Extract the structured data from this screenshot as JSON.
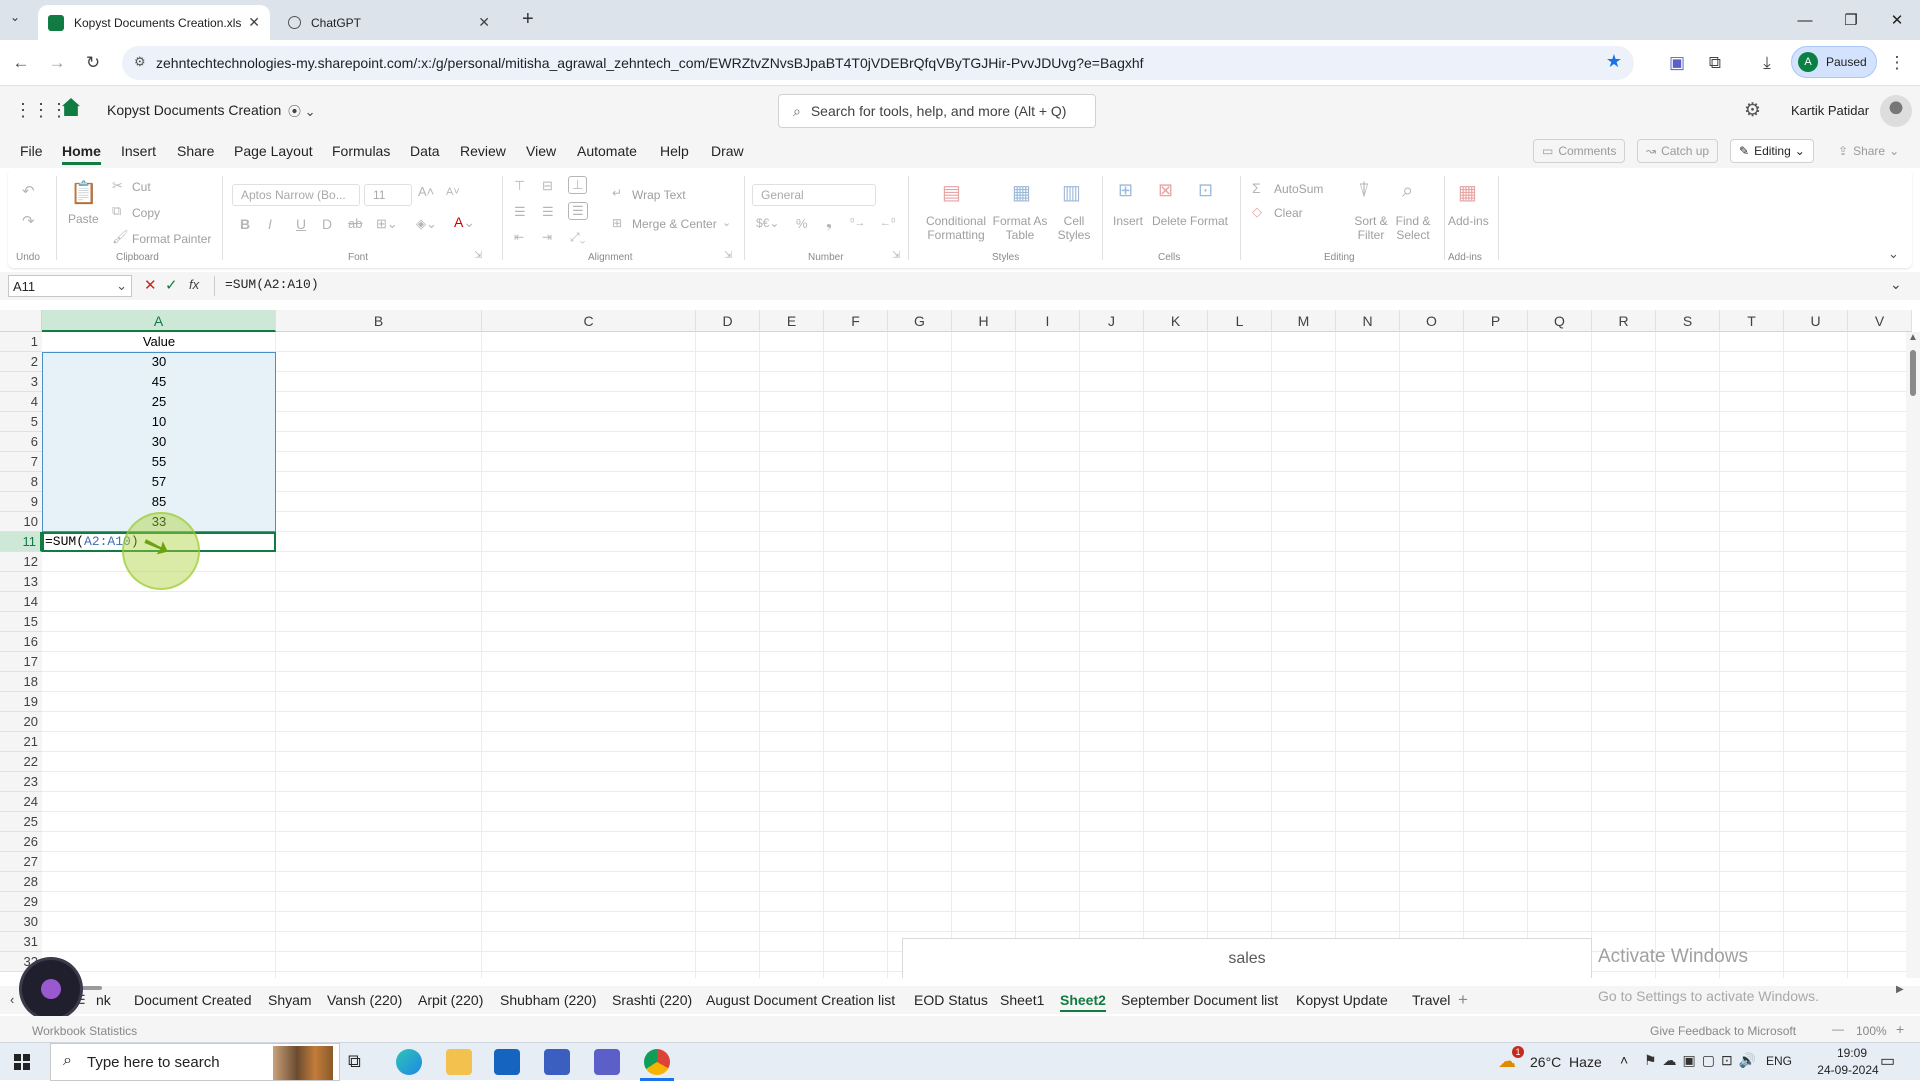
{
  "browser": {
    "tabs": [
      {
        "title": "Kopyst Documents Creation.xls",
        "active": true
      },
      {
        "title": "ChatGPT",
        "active": false
      }
    ],
    "url": "zehntechtechnologies-my.sharepoint.com/:x:/g/personal/mitisha_agrawal_zehntech_com/EWRZtvZNvsBJpaBT4T0jVDEBrQfqVByTGJHir-PvvJDUvg?e=Bagxhf",
    "profile_initial": "A",
    "profile_status": "Paused"
  },
  "app": {
    "workbook_title": "Kopyst Documents Creation",
    "search_placeholder": "Search for tools, help, and more (Alt + Q)",
    "user_name": "Kartik Patidar",
    "accent": "#107c41"
  },
  "ribbon_tabs": [
    "File",
    "Home",
    "Insert",
    "Share",
    "Page Layout",
    "Formulas",
    "Data",
    "Review",
    "View",
    "Automate",
    "Help",
    "Draw"
  ],
  "top_buttons": {
    "comments": "Comments",
    "catch_up": "Catch up",
    "editing": "Editing",
    "share": "Share"
  },
  "ribbon": {
    "undo_group": "Undo",
    "paste": "Paste",
    "cut": "Cut",
    "copy": "Copy",
    "format_painter": "Format Painter",
    "clipboard_group": "Clipboard",
    "font_name": "Aptos Narrow (Bo...",
    "font_size": "11",
    "font_group": "Font",
    "wrap_text": "Wrap Text",
    "merge_center": "Merge & Center",
    "alignment_group": "Alignment",
    "number_format": "General",
    "number_group": "Number",
    "conditional_formatting": "Conditional Formatting",
    "format_as_table": "Format As Table",
    "cell_styles": "Cell Styles",
    "styles_group": "Styles",
    "insert": "Insert",
    "delete": "Delete",
    "format": "Format",
    "cells_group": "Cells",
    "autosum": "AutoSum",
    "clear": "Clear",
    "sort_filter": "Sort & Filter",
    "find_select": "Find & Select",
    "editing_group": "Editing",
    "addins": "Add-ins",
    "addins_group": "Add-ins"
  },
  "formula_bar": {
    "name_box": "A11",
    "formula": "=SUM(A2:A10)"
  },
  "grid": {
    "columns": [
      "A",
      "B",
      "C",
      "D",
      "E",
      "F",
      "G",
      "H",
      "I",
      "J",
      "K",
      "L",
      "M",
      "N",
      "O",
      "P",
      "Q",
      "R",
      "S",
      "T",
      "U",
      "V"
    ],
    "rows": [
      "1",
      "2",
      "3",
      "4",
      "5",
      "6",
      "7",
      "8",
      "9",
      "10",
      "11",
      "12",
      "13",
      "14",
      "15",
      "16",
      "17",
      "18",
      "19",
      "20",
      "21",
      "22",
      "23",
      "24",
      "25",
      "26",
      "27",
      "28",
      "29",
      "30",
      "31",
      "32"
    ],
    "column_a": [
      "Value",
      "30",
      "45",
      "25",
      "10",
      "30",
      "55",
      "57",
      "85",
      "33"
    ],
    "editing_cell_prefix": "=SUM(",
    "editing_cell_ref": "A2:A10",
    "editing_cell_suffix": ")",
    "chart_title": "sales",
    "watermark_title": "Activate Windows",
    "watermark_sub": "Go to Settings to activate Windows."
  },
  "sheet_tabs": [
    "nk",
    "Document Created",
    "Shyam",
    "Vansh (220)",
    "Arpit (220)",
    "Shubham (220)",
    "Srashti (220)",
    "August Document Creation list",
    "EOD Status",
    "Sheet1",
    "Sheet2",
    "September Document list",
    "Kopyst Update",
    "Travel"
  ],
  "active_sheet": "Sheet2",
  "status": {
    "left": "Workbook Statistics",
    "feedback": "Give Feedback to Microsoft",
    "zoom": "100%"
  },
  "taskbar": {
    "search_placeholder": "Type here to search",
    "weather": "26°C  Haze",
    "weather_badge": "1",
    "lang": "ENG",
    "time": "19:09",
    "date": "24-09-2024"
  }
}
